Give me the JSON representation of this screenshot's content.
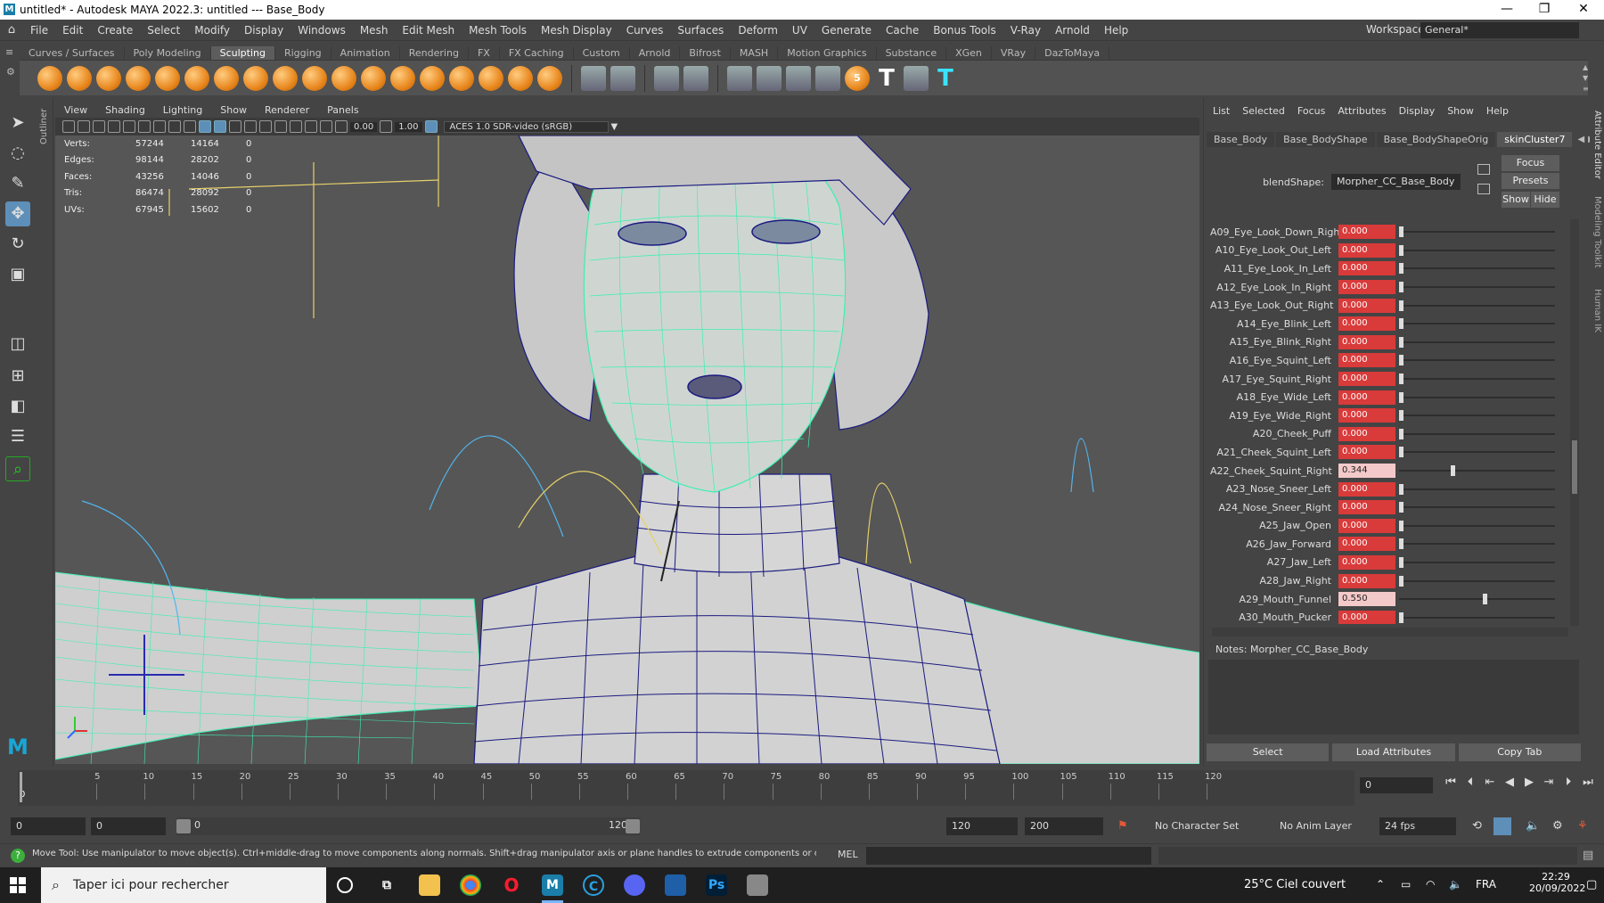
{
  "window": {
    "title": "untitled* - Autodesk MAYA 2022.3: untitled  ---  Base_Body",
    "minimize": "—",
    "maximize": "❐",
    "close": "✕"
  },
  "menubar": [
    "File",
    "Edit",
    "Create",
    "Select",
    "Modify",
    "Display",
    "Windows",
    "Mesh",
    "Edit Mesh",
    "Mesh Tools",
    "Mesh Display",
    "Curves",
    "Surfaces",
    "Deform",
    "UV",
    "Generate",
    "Cache",
    "Bonus Tools",
    "V-Ray",
    "Arnold",
    "Help"
  ],
  "workspace": {
    "label": "Workspace:",
    "value": "General*"
  },
  "shelf_tabs": [
    "Curves / Surfaces",
    "Poly Modeling",
    "Sculpting",
    "Rigging",
    "Animation",
    "Rendering",
    "FX",
    "FX Caching",
    "Custom",
    "Arnold",
    "Bifrost",
    "MASH",
    "Motion Graphics",
    "Substance",
    "XGen",
    "VRay",
    "DazToMaya"
  ],
  "shelf_active": "Sculpting",
  "outliner_label": "Outliner",
  "viewport_menu": [
    "View",
    "Shading",
    "Lighting",
    "Show",
    "Renderer",
    "Panels"
  ],
  "viewport_toolbar": {
    "exposure": "0.00",
    "gamma": "1.00",
    "color_space": "ACES 1.0 SDR-video (sRGB)"
  },
  "hud": [
    {
      "k": "Verts:",
      "a": "57244",
      "b": "14164",
      "c": "0"
    },
    {
      "k": "Edges:",
      "a": "98144",
      "b": "28202",
      "c": "0"
    },
    {
      "k": "Faces:",
      "a": "43256",
      "b": "14046",
      "c": "0"
    },
    {
      "k": "Tris:",
      "a": "86474",
      "b": "28092",
      "c": "0"
    },
    {
      "k": "UVs:",
      "a": "67945",
      "b": "15602",
      "c": "0"
    }
  ],
  "attribute_editor": {
    "menu": [
      "List",
      "Selected",
      "Focus",
      "Attributes",
      "Display",
      "Show",
      "Help"
    ],
    "tabs": [
      "Base_Body",
      "Base_BodyShape",
      "Base_BodyShapeOrig",
      "skinCluster7"
    ],
    "blend_label": "blendShape:",
    "blend_value": "Morpher_CC_Base_Body",
    "focus_btn": "Focus",
    "presets_btn": "Presets",
    "show_btn": "Show",
    "hide_btn": "Hide",
    "notes_label": "Notes:  Morpher_CC_Base_Body",
    "select_btn": "Select",
    "load_btn": "Load Attributes",
    "copy_btn": "Copy Tab",
    "side_labels": [
      "Attribute Editor",
      "Modeling Toolkit",
      "Human IK"
    ],
    "attrs": [
      {
        "name": "A09_Eye_Look_Down_Right",
        "value": "0.000",
        "level": 0
      },
      {
        "name": "A10_Eye_Look_Out_Left",
        "value": "0.000",
        "level": 0
      },
      {
        "name": "A11_Eye_Look_In_Left",
        "value": "0.000",
        "level": 0
      },
      {
        "name": "A12_Eye_Look_In_Right",
        "value": "0.000",
        "level": 0
      },
      {
        "name": "A13_Eye_Look_Out_Right",
        "value": "0.000",
        "level": 0
      },
      {
        "name": "A14_Eye_Blink_Left",
        "value": "0.000",
        "level": 0
      },
      {
        "name": "A15_Eye_Blink_Right",
        "value": "0.000",
        "level": 0
      },
      {
        "name": "A16_Eye_Squint_Left",
        "value": "0.000",
        "level": 0
      },
      {
        "name": "A17_Eye_Squint_Right",
        "value": "0.000",
        "level": 0
      },
      {
        "name": "A18_Eye_Wide_Left",
        "value": "0.000",
        "level": 0
      },
      {
        "name": "A19_Eye_Wide_Right",
        "value": "0.000",
        "level": 0
      },
      {
        "name": "A20_Cheek_Puff",
        "value": "0.000",
        "level": 0
      },
      {
        "name": "A21_Cheek_Squint_Left",
        "value": "0.000",
        "level": 0
      },
      {
        "name": "A22_Cheek_Squint_Right",
        "value": "0.344",
        "level": 0.344
      },
      {
        "name": "A23_Nose_Sneer_Left",
        "value": "0.000",
        "level": 0
      },
      {
        "name": "A24_Nose_Sneer_Right",
        "value": "0.000",
        "level": 0
      },
      {
        "name": "A25_Jaw_Open",
        "value": "0.000",
        "level": 0
      },
      {
        "name": "A26_Jaw_Forward",
        "value": "0.000",
        "level": 0
      },
      {
        "name": "A27_Jaw_Left",
        "value": "0.000",
        "level": 0
      },
      {
        "name": "A28_Jaw_Right",
        "value": "0.000",
        "level": 0
      },
      {
        "name": "A29_Mouth_Funnel",
        "value": "0.550",
        "level": 0.55
      },
      {
        "name": "A30_Mouth_Pucker",
        "value": "0.000",
        "level": 0
      }
    ]
  },
  "timeline": {
    "ticks": [
      "5",
      "10",
      "15",
      "20",
      "25",
      "30",
      "35",
      "40",
      "45",
      "50",
      "55",
      "60",
      "65",
      "70",
      "75",
      "80",
      "85",
      "90",
      "95",
      "100",
      "105",
      "110",
      "115",
      "120"
    ],
    "current_frame": "0",
    "start_marker": "0"
  },
  "range": {
    "start": "0",
    "inner_start": "0",
    "slider_start": "0",
    "slider_end": "120",
    "end": "120",
    "anim_end": "200",
    "character_set": "No Character Set",
    "anim_layer": "No Anim Layer",
    "fps": "24 fps"
  },
  "help_line": "Move Tool: Use manipulator to move object(s). Ctrl+middle-drag to move components along normals. Shift+drag manipulator axis or plane handles to extrude components or clone objects. Ctrl+Shift+drag to constrain movement",
  "mel_label": "MEL",
  "taskbar": {
    "search_placeholder": "Taper ici pour rechercher",
    "weather": "25°C  Ciel couvert",
    "lang": "FRA",
    "time": "22:29",
    "date": "20/09/2022"
  },
  "colors": {
    "accent": "#5e8fb8",
    "zero_field": "#d93a3a",
    "set_field": "#f4c9c9",
    "wire": "#3cf0b0"
  }
}
